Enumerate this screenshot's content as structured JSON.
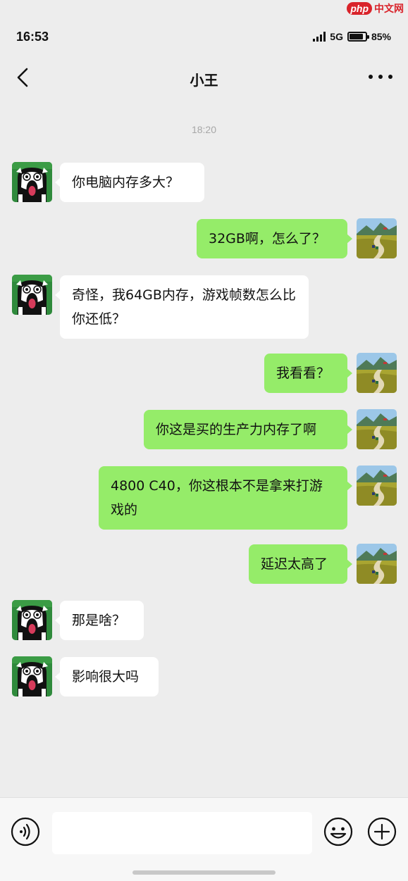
{
  "status": {
    "time": "16:53",
    "network": "5G",
    "battery": "85%",
    "battery_level": 0.85
  },
  "watermark": {
    "brand": "php",
    "site": "中文网"
  },
  "header": {
    "title": "小王"
  },
  "timestamp": "18:20",
  "messages": [
    {
      "from": "other",
      "text": "你电脑内存多大？"
    },
    {
      "from": "me",
      "text": "32GB啊，怎么了？"
    },
    {
      "from": "other",
      "text": "奇怪，我64GB内存，游戏帧数怎么比你还低？"
    },
    {
      "from": "me",
      "text": "我看看？"
    },
    {
      "from": "me",
      "text": "你这是买的生产力内存了啊"
    },
    {
      "from": "me",
      "text": "4800 C40，你这根本不是拿来打游戏的"
    },
    {
      "from": "me",
      "text": "延迟太高了"
    },
    {
      "from": "other",
      "text": "那是啥？"
    },
    {
      "from": "other",
      "text": "影响很大吗"
    }
  ],
  "icons": {
    "back": "chevron-left-icon",
    "more": "more-dots-icon",
    "voice": "voice-icon",
    "emoji": "emoji-icon",
    "plus": "plus-icon"
  },
  "colors": {
    "background": "#ededed",
    "incoming_bubble": "#ffffff",
    "outgoing_bubble": "#95ec69",
    "timestamp": "#a7a7a7"
  }
}
